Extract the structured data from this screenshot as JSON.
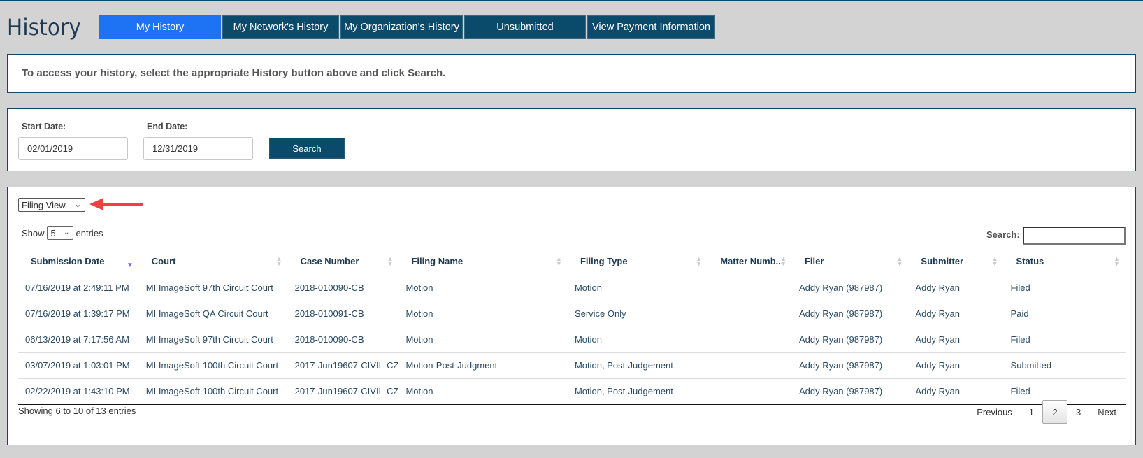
{
  "header": {
    "title": "History",
    "tabs": [
      {
        "label": "My History",
        "active": true
      },
      {
        "label": "My Network's History",
        "active": false
      },
      {
        "label": "My Organization's History",
        "active": false
      },
      {
        "label": "Unsubmitted",
        "active": false
      },
      {
        "label": "View Payment Information",
        "active": false
      }
    ]
  },
  "info": {
    "message": "To access your history, select the appropriate History button above and click Search."
  },
  "search_form": {
    "start_date_label": "Start Date:",
    "start_date_value": "02/01/2019",
    "end_date_label": "End Date:",
    "end_date_value": "12/31/2019",
    "search_button": "Search"
  },
  "results": {
    "view_select": "Filing View",
    "show_label": "Show",
    "page_length": "5",
    "entries_label": "entries",
    "search_label": "Search:",
    "search_value": "",
    "columns": [
      "Submission Date",
      "Court",
      "Case Number",
      "Filing Name",
      "Filing Type",
      "Matter Numb...",
      "Filer",
      "Submitter",
      "Status"
    ],
    "sorted_column": "Submission Date",
    "sort_direction": "descending",
    "rows": [
      [
        "07/16/2019 at 2:49:11 PM",
        "MI ImageSoft 97th Circuit Court",
        "2018-010090-CB",
        "Motion",
        "Motion",
        "",
        "Addy Ryan (987987)",
        "Addy Ryan",
        "Filed"
      ],
      [
        "07/16/2019 at 1:39:17 PM",
        "MI ImageSoft QA Circuit Court",
        "2018-010091-CB",
        "Motion",
        "Service Only",
        "",
        "Addy Ryan (987987)",
        "Addy Ryan",
        "Paid"
      ],
      [
        "06/13/2019 at 7:17:56 AM",
        "MI ImageSoft 97th Circuit Court",
        "2018-010090-CB",
        "Motion",
        "Motion",
        "",
        "Addy Ryan (987987)",
        "Addy Ryan",
        "Filed"
      ],
      [
        "03/07/2019 at 1:03:01 PM",
        "MI ImageSoft 100th Circuit Court",
        "2017-Jun19607-CIVIL-CZ",
        "Motion-Post-Judgment",
        "Motion, Post-Judgement",
        "",
        "Addy Ryan (987987)",
        "Addy Ryan",
        "Submitted"
      ],
      [
        "02/22/2019 at 1:43:10 PM",
        "MI ImageSoft 100th Circuit Court",
        "2017-Jun19607-CIVIL-CZ",
        "Motion",
        "Motion, Post-Judgement",
        "",
        "Addy Ryan (987987)",
        "Addy Ryan",
        "Filed"
      ]
    ],
    "summary": "Showing 6 to 10 of 13 entries",
    "pagination": {
      "previous": "Previous",
      "pages": [
        "1",
        "2",
        "3"
      ],
      "current": "2",
      "next": "Next"
    }
  },
  "colors": {
    "primary": "#0a4a6a",
    "active_tab": "#1e73f5",
    "annotation_arrow": "#f04040",
    "sort_active": "#6e6ee0"
  }
}
